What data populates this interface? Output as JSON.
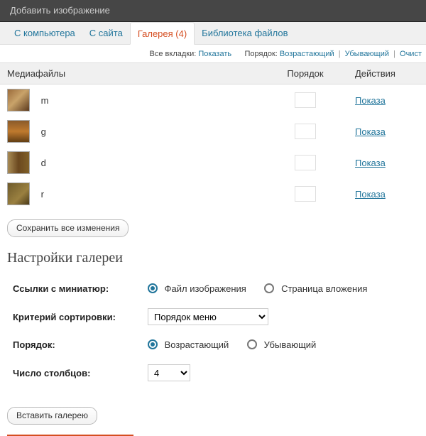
{
  "header": {
    "title": "Добавить изображение"
  },
  "tabs": [
    {
      "label": "С компьютера"
    },
    {
      "label": "С сайта"
    },
    {
      "label": "Галерея (4)",
      "active": true
    },
    {
      "label": "Библиотека файлов"
    }
  ],
  "toolbar": {
    "all_tabs": "Все вкладки:",
    "show": "Показать",
    "order_label": "Порядок:",
    "asc": "Возрастающий",
    "desc": "Убывающий",
    "clear": "Очист"
  },
  "table": {
    "col_media": "Медиафайлы",
    "col_order": "Порядок",
    "col_actions": "Действия",
    "action_show": "Показа",
    "rows": [
      {
        "name": "m"
      },
      {
        "name": "g"
      },
      {
        "name": "d"
      },
      {
        "name": "r"
      }
    ]
  },
  "buttons": {
    "save_all": "Сохранить все изменения",
    "insert_gallery": "Вставить галерею"
  },
  "settings": {
    "title": "Настройки галереи",
    "link_label": "Ссылки с миниатюр:",
    "link_file": "Файл изображения",
    "link_page": "Страница вложения",
    "sort_label": "Критерий сортировки:",
    "sort_value": "Порядок меню",
    "order_label": "Порядок:",
    "order_asc": "Возрастающий",
    "order_desc": "Убывающий",
    "cols_label": "Число столбцов:",
    "cols_value": "4"
  }
}
